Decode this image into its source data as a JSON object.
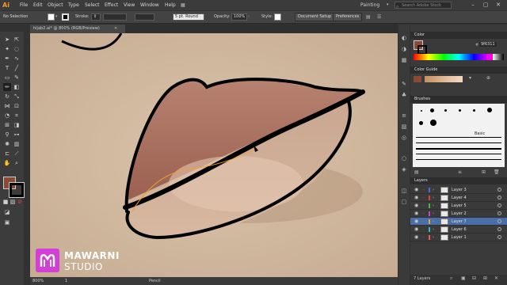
{
  "app": {
    "logo": "Ai"
  },
  "menubar": {
    "items": [
      "File",
      "Edit",
      "Object",
      "Type",
      "Select",
      "Effect",
      "View",
      "Window",
      "Help"
    ],
    "workspace": "Painting",
    "search_placeholder": "Search Adobe Stock"
  },
  "control_bar": {
    "selection": "No Selection",
    "stroke_label": "Stroke:",
    "brush": "5 pt. Round",
    "opacity_label": "Opacity:",
    "opacity_value": "100%",
    "style_label": "Style:",
    "document_setup": "Document Setup",
    "preferences": "Preferences"
  },
  "document": {
    "tab_title": "hijab2.ai* @ 800% (RGB/Preview)"
  },
  "status_bar": {
    "zoom": "800%",
    "page": "1",
    "tool": "Pencil"
  },
  "panels": {
    "color": {
      "title": "Color",
      "hex": "9f6311"
    },
    "color_guide": {
      "title": "Color Guide"
    },
    "brushes": {
      "title": "Brushes",
      "basic_label": "Basic"
    },
    "layers": {
      "title": "Layers",
      "rows": [
        {
          "name": "Layer 3",
          "color": "#4a6cf0",
          "selected": false
        },
        {
          "name": "Layer 4",
          "color": "#e04040",
          "selected": false
        },
        {
          "name": "Layer 5",
          "color": "#38c038",
          "selected": false
        },
        {
          "name": "Layer 2",
          "color": "#d040d0",
          "selected": false
        },
        {
          "name": "Layer 7",
          "color": "#f0a030",
          "selected": true
        },
        {
          "name": "Layer 6",
          "color": "#40b0e0",
          "selected": false
        },
        {
          "name": "Layer 1",
          "color": "#ff5050",
          "selected": false
        }
      ],
      "count_label": "7 Layers"
    }
  },
  "branding": {
    "line1": "MAWARNI",
    "line2": "STUDIO"
  },
  "colors": {
    "fill_swatch": "#8a4a36",
    "accent": "#f59a23",
    "layer_selected": "#4a6fa8"
  }
}
